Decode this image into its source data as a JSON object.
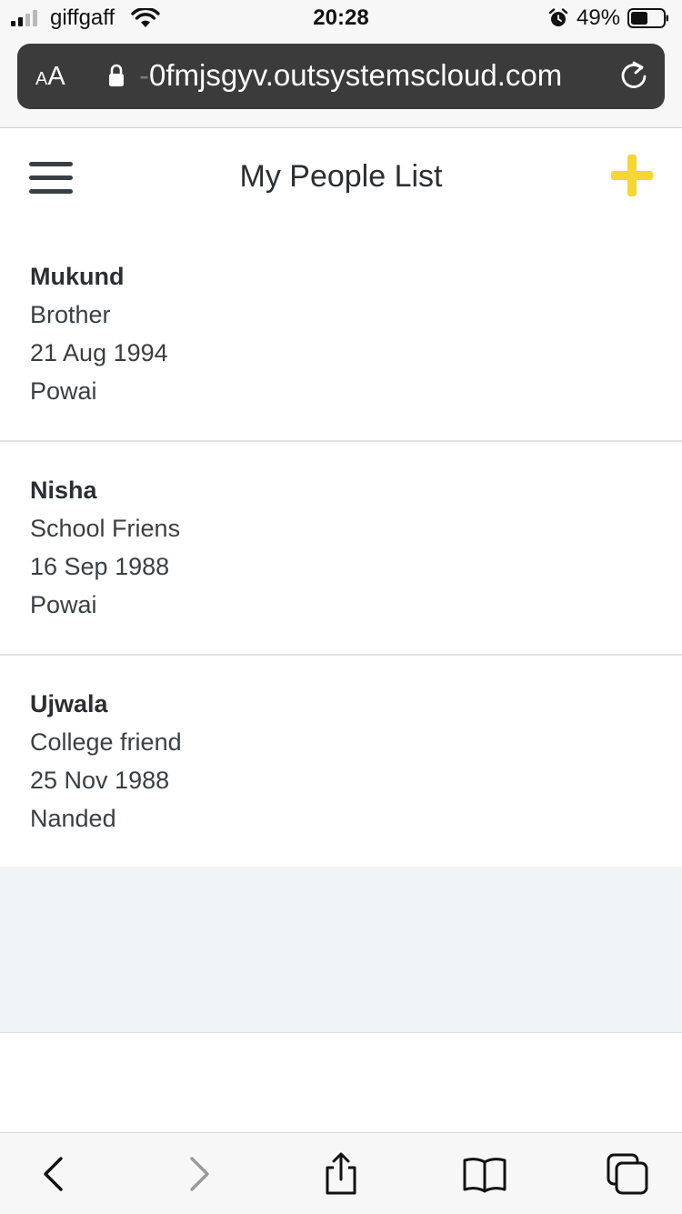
{
  "status_bar": {
    "carrier": "giffgaff",
    "time": "20:28",
    "battery_percent": "49%",
    "signal_bars_active": 2,
    "icons": [
      "signal-icon",
      "wifi-icon",
      "alarm-icon",
      "battery-icon"
    ]
  },
  "browser": {
    "text_size_small": "A",
    "text_size_large": "A",
    "url_prefix": "-",
    "url": "0fmjsgyv.outsystemscloud.com",
    "icons": [
      "lock-icon",
      "reload-icon"
    ]
  },
  "app_header": {
    "title": "My People List",
    "icons": [
      "hamburger-menu-icon",
      "add-icon"
    ],
    "accent_color": "#f5d633"
  },
  "people": [
    {
      "name": "Mukund",
      "relation": "Brother",
      "date": "21 Aug 1994",
      "place": "Powai"
    },
    {
      "name": "Nisha",
      "relation": "School Friens",
      "date": "16 Sep 1988",
      "place": "Powai"
    },
    {
      "name": "Ujwala",
      "relation": "College friend",
      "date": "25 Nov 1988",
      "place": "Nanded"
    }
  ],
  "toolbar": {
    "icons": [
      "back-icon",
      "forward-icon",
      "share-icon",
      "bookmarks-icon",
      "tabs-icon"
    ]
  }
}
